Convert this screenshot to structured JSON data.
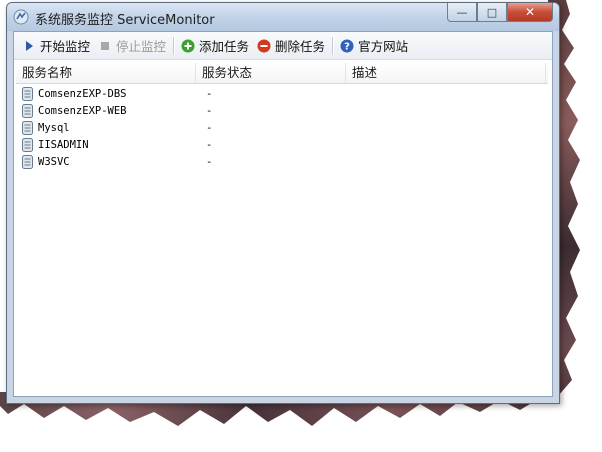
{
  "window": {
    "title": "系统服务监控 ServiceMonitor",
    "buttons": {
      "minimize": "—",
      "maximize": "□",
      "close": "✕"
    }
  },
  "toolbar": {
    "start": {
      "label": "开始监控",
      "icon": "play-icon",
      "enabled": true
    },
    "stop": {
      "label": "停止监控",
      "icon": "stop-icon",
      "enabled": false
    },
    "add": {
      "label": "添加任务",
      "icon": "plus-circle-icon",
      "enabled": true
    },
    "delete": {
      "label": "删除任务",
      "icon": "minus-circle-icon",
      "enabled": true
    },
    "website": {
      "label": "官方网站",
      "icon": "help-circle-icon",
      "enabled": true
    }
  },
  "table": {
    "columns": [
      "服务名称",
      "服务状态",
      "描述"
    ],
    "rows": [
      {
        "name": "ComsenzEXP-DBS",
        "status": "-",
        "desc": ""
      },
      {
        "name": "ComsenzEXP-WEB",
        "status": "-",
        "desc": ""
      },
      {
        "name": "Mysql",
        "status": "-",
        "desc": ""
      },
      {
        "name": "IISADMIN",
        "status": "-",
        "desc": ""
      },
      {
        "name": "W3SVC",
        "status": "-",
        "desc": ""
      }
    ]
  },
  "colors": {
    "add_green": "#3aa02e",
    "delete_red": "#d23a1e",
    "help_blue": "#2f62b8",
    "play_blue": "#2c5aa8"
  }
}
